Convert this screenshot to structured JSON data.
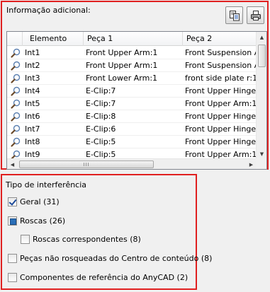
{
  "info_panel": {
    "title": "Informação adicional:",
    "copy_button_icon": "copy-icon",
    "print_button_icon": "print-icon",
    "columns": [
      "Elemento",
      "Peça 1",
      "Peça 2"
    ],
    "rows": [
      {
        "elemento": "Int1",
        "peca1": "Front Upper Arm:1",
        "peca2": "Front Suspension Ad"
      },
      {
        "elemento": "Int2",
        "peca1": "Front Upper Arm:1",
        "peca2": "Front Suspension Ad"
      },
      {
        "elemento": "Int3",
        "peca1": "Front Lower Arm:1",
        "peca2": "front side plate r:1"
      },
      {
        "elemento": "Int4",
        "peca1": "E-Clip:7",
        "peca2": "Front Upper Hinge P"
      },
      {
        "elemento": "Int5",
        "peca1": "E-Clip:7",
        "peca2": "Front Upper Arm:1"
      },
      {
        "elemento": "Int6",
        "peca1": "E-Clip:8",
        "peca2": "Front Upper Hinge P"
      },
      {
        "elemento": "Int7",
        "peca1": "E-Clip:6",
        "peca2": "Front Upper Hinge P"
      },
      {
        "elemento": "Int8",
        "peca1": "E-Clip:5",
        "peca2": "Front Upper Hinge P"
      },
      {
        "elemento": "Int9",
        "peca1": "E-Clip:5",
        "peca2": "Front Upper Arm:1"
      }
    ],
    "hscroll_grip": "III"
  },
  "interference_panel": {
    "title": "Tipo de interferência",
    "options": [
      {
        "label": "Geral (31)",
        "state": "checked"
      },
      {
        "label": "Roscas (26)",
        "state": "partial"
      },
      {
        "label": "Roscas correspondentes (8)",
        "state": "unchecked"
      },
      {
        "label": "Peças não rosqueadas do Centro de conteúdo (8)",
        "state": "unchecked"
      },
      {
        "label": "Componentes de referência do AnyCAD (2)",
        "state": "unchecked"
      }
    ]
  }
}
